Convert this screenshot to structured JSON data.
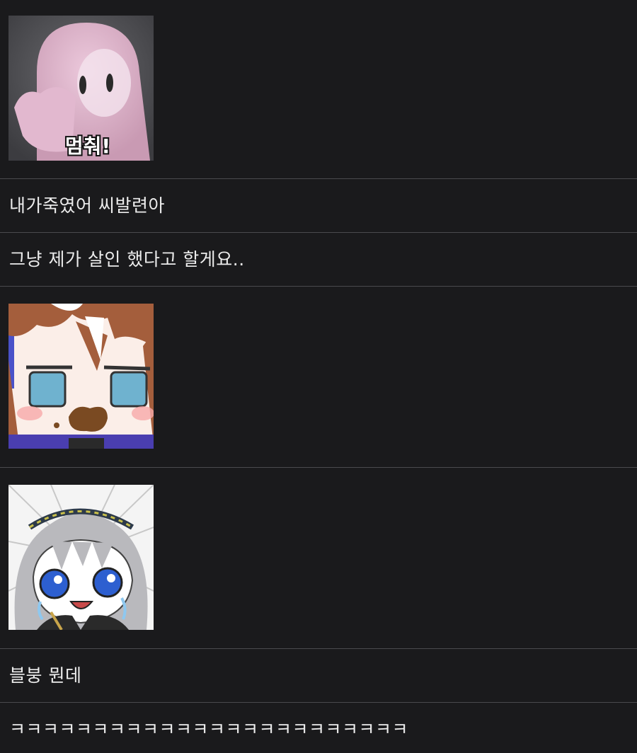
{
  "comments": [
    {
      "type": "sticker",
      "sticker": "pink-ghost-stop-sticker",
      "caption": "멈춰!"
    },
    {
      "type": "text",
      "text": "내가죽였어 씨발련아"
    },
    {
      "type": "text",
      "text": "그냥 제가 살인 했다고 할게요.."
    },
    {
      "type": "sticker",
      "sticker": "anime-girl-eating-sticker"
    },
    {
      "type": "sticker",
      "sticker": "anime-girl-crying-sticker"
    },
    {
      "type": "text",
      "text": "블붕 뭔데"
    },
    {
      "type": "text",
      "text": "ㅋㅋㅋㅋㅋㅋㅋㅋㅋㅋㅋㅋㅋㅋㅋㅋㅋㅋㅋㅋㅋㅋㅋㅋ"
    }
  ],
  "colors": {
    "background": "#1a1a1c",
    "divider": "#4a4a4e",
    "text": "#ececec"
  }
}
